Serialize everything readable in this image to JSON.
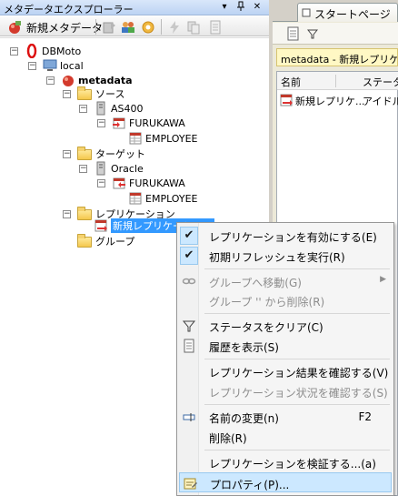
{
  "explorer": {
    "title": "メタデータエクスプローラー",
    "pin_glyph": "ᵖ",
    "close_glyph": "✕",
    "toolbar": {
      "new_label": "新規メタデータ"
    }
  },
  "tree": {
    "root": "DBMoto",
    "local": "local",
    "metadata": "metadata",
    "source": "ソース",
    "source_server": "AS400",
    "source_lib": "FURUKAWA",
    "source_table": "EMPLOYEE",
    "target": "ターゲット",
    "target_server": "Oracle",
    "target_lib": "FURUKAWA",
    "target_table": "EMPLOYEE",
    "replication": "レプリケーション",
    "replication_item": "新規レプリケーション",
    "group": "グループ"
  },
  "right": {
    "tab_label": "スタートページ",
    "status_text": "metadata - 新規レプリケーション",
    "col_name": "名前",
    "col_status": "ステータス",
    "row_name": "新規レプリケ...",
    "row_status": "アイドル"
  },
  "menu": {
    "enable": "レプリケーションを有効にする(E)",
    "initial_refresh": "初期リフレッシュを実行(R)",
    "move_group": "グループへ移動(G)",
    "remove_group": "グループ '' から削除(R)",
    "clear_status": "ステータスをクリア(C)",
    "show_history": "履歴を表示(S)",
    "check_results": "レプリケーション結果を確認する(V)",
    "check_status": "レプリケーション状況を確認する(S)",
    "rename": "名前の変更(n)",
    "rename_shortcut": "F2",
    "delete": "削除(R)",
    "validate": "レプリケーションを検証する...(a)",
    "properties": "プロパティ(P)...",
    "submenu_arrow": "▶",
    "check_glyph": "✔"
  },
  "colors": {
    "selection": "#3399ff",
    "menu_highlight": "#cce8ff",
    "header_gradient_top": "#d9e7fa"
  }
}
